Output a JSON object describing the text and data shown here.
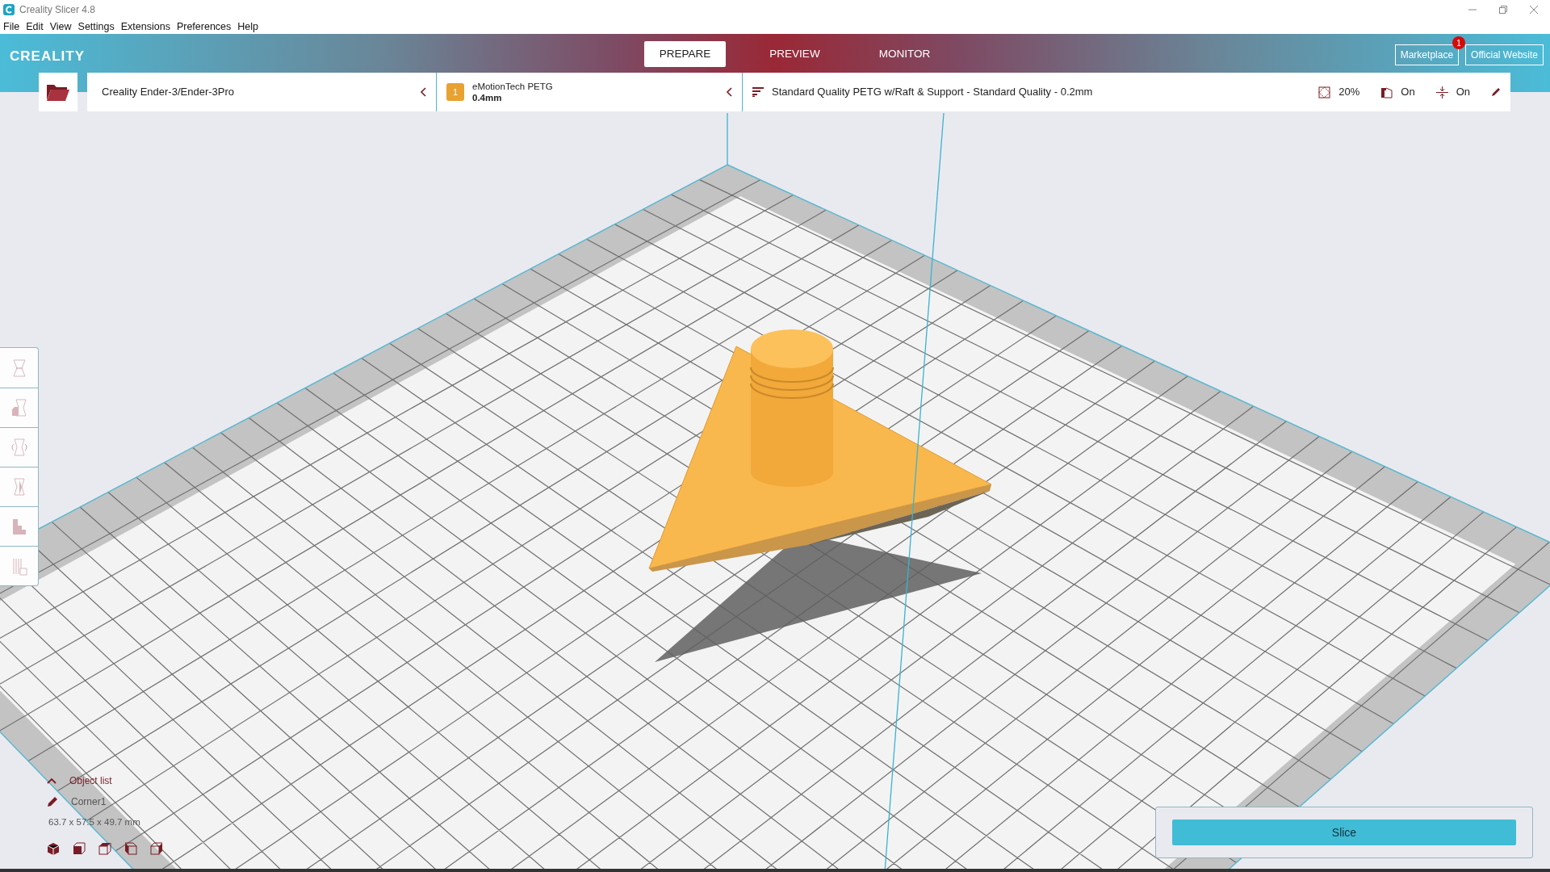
{
  "window": {
    "title": "Creality Slicer 4.8"
  },
  "menu": [
    "File",
    "Edit",
    "View",
    "Settings",
    "Extensions",
    "Preferences",
    "Help"
  ],
  "header": {
    "logo": "CREALITY",
    "tabs": [
      {
        "label": "PREPARE",
        "selected": true
      },
      {
        "label": "PREVIEW",
        "selected": false
      },
      {
        "label": "MONITOR",
        "selected": false
      }
    ],
    "buttons": [
      {
        "label": "Marketplace",
        "badge": "1"
      },
      {
        "label": "Official Website"
      }
    ]
  },
  "config_bar": {
    "printer": "Creality Ender-3/Ender-3Pro",
    "extruder": {
      "number": "1",
      "material": "eMotionTech PETG",
      "nozzle": "0.4mm"
    },
    "profile": "Standard Quality PETG w/Raft & Support - Standard Quality - 0.2mm",
    "infill": "20%",
    "support": "On",
    "adhesion": "On"
  },
  "object_list": {
    "title": "Object list",
    "expanded": true,
    "object_name": "Corner1",
    "dimensions": "63.7 x 57.5 x 49.7 mm"
  },
  "slice_button": "Slice"
}
